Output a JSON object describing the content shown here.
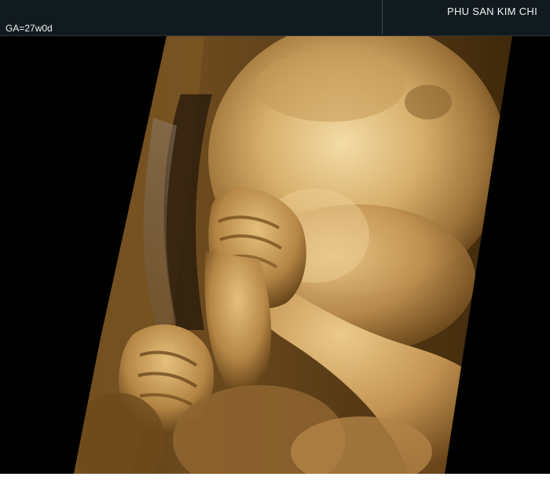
{
  "header": {
    "clinic_name": "PHU SAN KIM CHI",
    "gestational_age": "GA=27w0d"
  },
  "render": {
    "subject": "3D fetal ultrasound rendering, hands near face",
    "colors": {
      "background": "#000000",
      "header": "#111a1f",
      "skin_highlight": "#f0d49a",
      "skin_mid": "#c79a55",
      "skin_shadow": "#5a3a16"
    }
  }
}
